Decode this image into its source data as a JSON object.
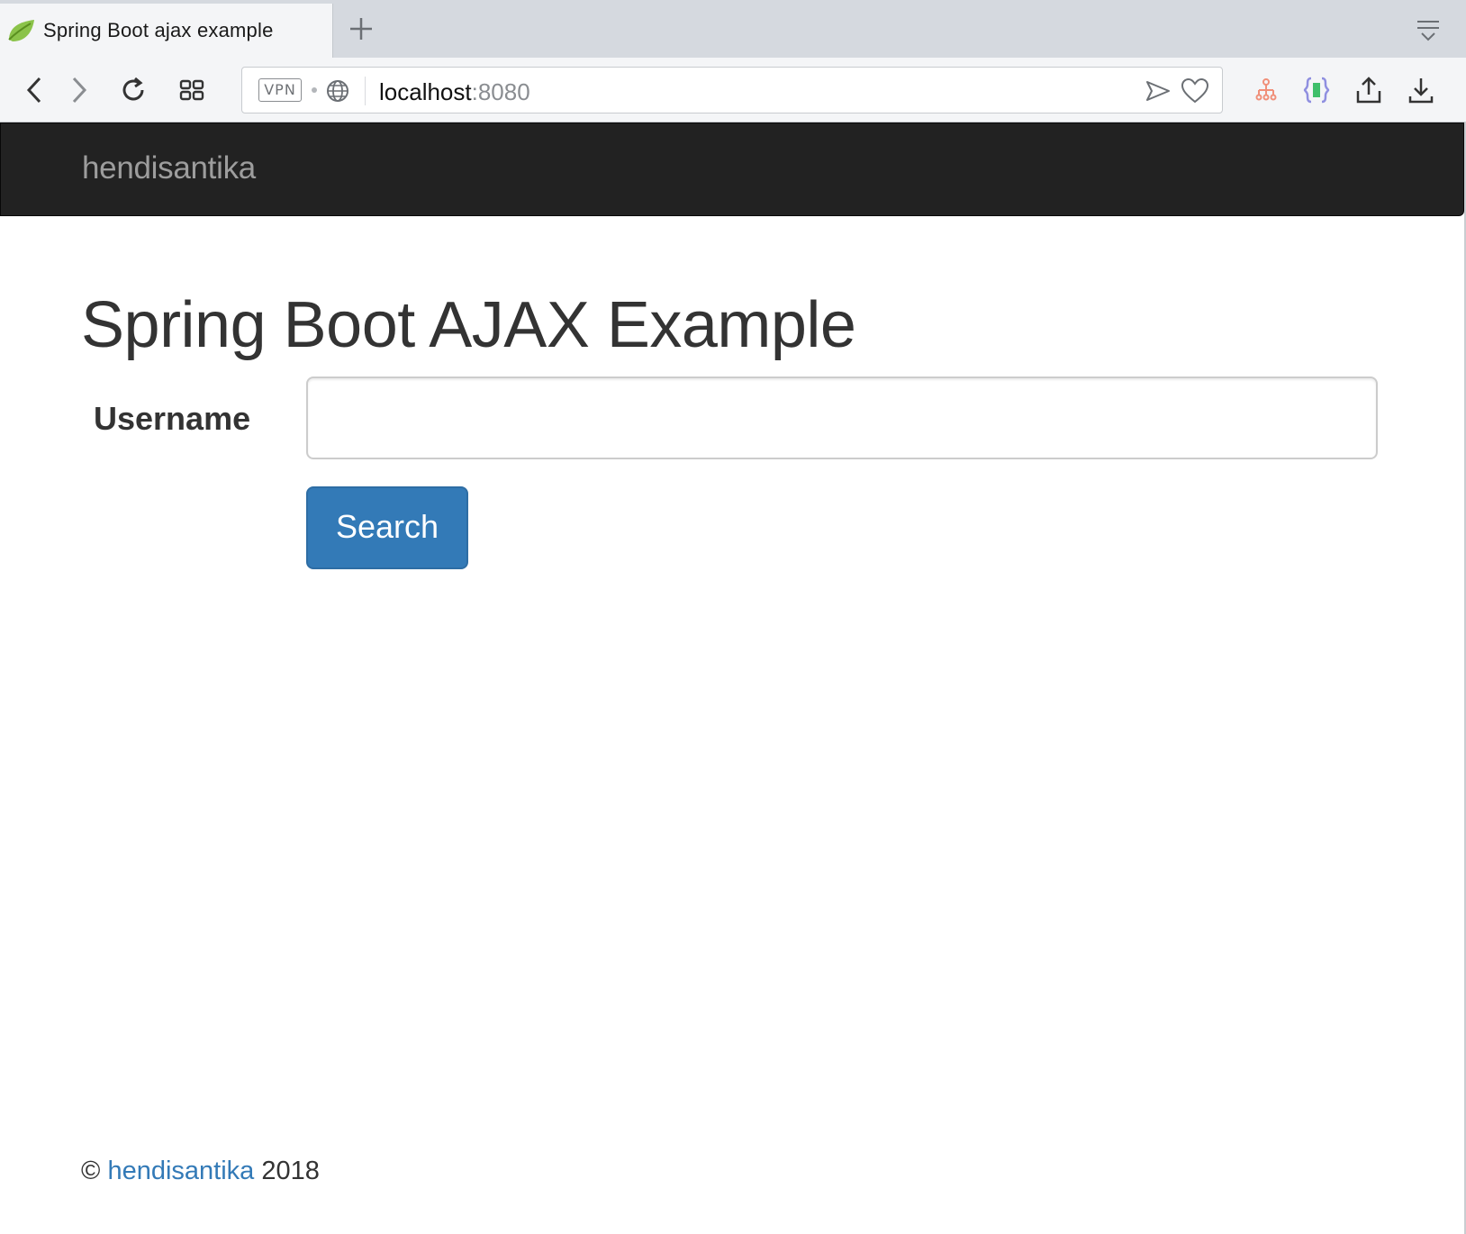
{
  "browser": {
    "tab": {
      "title": "Spring Boot ajax example",
      "favicon": "spring-leaf-icon"
    },
    "new_tab_icon": "plus-icon",
    "tab_menu_icon": "tab-list-icon",
    "toolbar": {
      "back_icon": "chevron-left-icon",
      "forward_icon": "chevron-right-icon",
      "reload_icon": "reload-icon",
      "speed_dial_icon": "grid-icon",
      "extensions": [
        "sitemap-icon",
        "json-viewer-icon",
        "share-icon",
        "download-icon"
      ]
    },
    "address_bar": {
      "vpn_label": "VPN",
      "host": "localhost",
      "port": ":8080"
    }
  },
  "page": {
    "navbar": {
      "brand": "hendisantika",
      "bg_color": "#222222",
      "brand_color": "#9d9d9d"
    },
    "title": "Spring Boot AJAX Example",
    "form": {
      "username_label": "Username",
      "username_value": "",
      "search_button": "Search",
      "button_color": "#337ab7"
    },
    "footer": {
      "copyright": "©",
      "author_link": "hendisantika",
      "year": "2018",
      "link_color": "#337ab7"
    }
  }
}
